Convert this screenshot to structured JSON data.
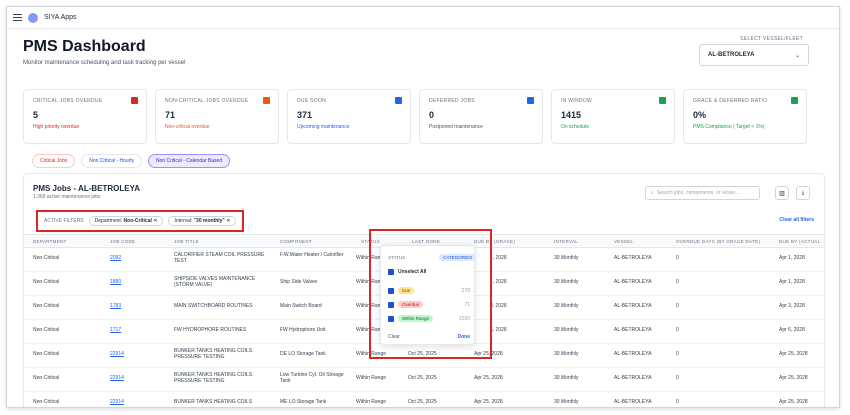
{
  "app_name": "SIYA Apps",
  "page": {
    "title": "PMS Dashboard",
    "subtitle": "Monitor maintenance scheduling and task tracking per vessel",
    "vessel_label": "SELECT VESSEL/FLEET",
    "vessel_value": "AL-BETROLEYA"
  },
  "cards": [
    {
      "label": "CRITICAL JOBS OVERDUE",
      "value": "5",
      "sub": "High priority overdue",
      "color": "#dc2626"
    },
    {
      "label": "NON-CRITICAL JOBS OVERDUE",
      "value": "71",
      "sub": "Non-critical overdue",
      "color": "#ea580c"
    },
    {
      "label": "DUE SOON",
      "value": "371",
      "sub": "Upcoming maintenance",
      "color": "#2563eb"
    },
    {
      "label": "DEFERRED JOBS",
      "value": "0",
      "sub": "Postponed maintenance",
      "color": "#2563eb"
    },
    {
      "label": "IN WINDOW",
      "value": "1415",
      "sub": "On schedule",
      "color": "#16a34a"
    },
    {
      "label": "GRACE & DEFERRED RATIO",
      "value": "0%",
      "sub": "PMS Compliance ( Target < 1%)",
      "color": "#16a34a"
    }
  ],
  "tabs": [
    "Critical Jobs",
    "Non Critical - Hourly",
    "Non Critical - Calendar Based"
  ],
  "panel": {
    "title": "PMS Jobs - AL-BETROLEYA",
    "subtitle": "1,369 active maintenance jobs",
    "search_placeholder": "Search jobs, components, or vesse...",
    "active_filters_label": "ACTIVE FILTERS",
    "filter1_key": "Department:",
    "filter1_val": "Non-Critical",
    "filter2_key": "Interval:",
    "filter2_val": "\"30 monthly\"",
    "clear_all": "Clear all filters"
  },
  "columns": [
    "DEPARTMENT",
    "JOB CODE",
    "JOB TITLE",
    "COMPONENT",
    "STATUS",
    "LAST DONE",
    "DUE BY (GRACE)",
    "INTERVAL",
    "VESSEL",
    "OVERDUE DAYS (BY GRACE DATE)",
    "DUE BY (ACTUAL"
  ],
  "rows": [
    {
      "dept": "Non-Critical",
      "code": "2092",
      "title": "CALORIFIER STEAM COIL PRESSURE TEST",
      "comp": "F.W.Water Heater / Calorifier",
      "status": "Within Rang",
      "last": "",
      "due": "1, 2028",
      "interval": "30 Monthly",
      "vessel": "AL-BETROLEYA",
      "overdue": "0",
      "actual": "Apr 1, 2028"
    },
    {
      "dept": "Non-Critical",
      "code": "1880",
      "title": "SHIPSIDE VALVES MAINTENANCE (STORM VALVE)",
      "comp": "Ship Side Valves",
      "status": "Within Rang",
      "last": "",
      "due": "1, 2028",
      "interval": "30 Monthly",
      "vessel": "AL-BETROLEYA",
      "overdue": "0",
      "actual": "Apr 1, 2028"
    },
    {
      "dept": "Non-Critical",
      "code": "1783",
      "title": "MAIN SWITCHBOARD ROUTINES",
      "comp": "Main Switch Board",
      "status": "Within Rang",
      "last": "",
      "due": "3, 2028",
      "interval": "30 Monthly",
      "vessel": "AL-BETROLEYA",
      "overdue": "0",
      "actual": "Apr 3, 2028"
    },
    {
      "dept": "Non-Critical",
      "code": "1717",
      "title": "FW HYDROPHORE ROUTINES",
      "comp": "FW Hydrophore Unit",
      "status": "Within Rang",
      "last": "",
      "due": "6, 2028",
      "interval": "30 Monthly",
      "vessel": "AL-BETROLEYA",
      "overdue": "0",
      "actual": "Apr 6, 2028"
    },
    {
      "dept": "Non-Critical",
      "code": "22914",
      "title": "BUNKER TANKS HEATING COILS PRESSURE TESTING",
      "comp": "DE LO Storage Tank",
      "status": "Within Range",
      "last": "Oct 25, 2025",
      "due": "Apr 25, 2028",
      "interval": "30 Monthly",
      "vessel": "AL-BETROLEYA",
      "overdue": "0",
      "actual": "Apr 25, 2028"
    },
    {
      "dept": "Non-Critical",
      "code": "22914",
      "title": "BUNKER TANKS HEATING COILS PRESSURE TESTING",
      "comp": "Low Turbine Cyl. Oil Storage Tank",
      "status": "Within Range",
      "last": "Oct 25, 2025",
      "due": "Apr 25, 2028",
      "interval": "30 Monthly",
      "vessel": "AL-BETROLEYA",
      "overdue": "0",
      "actual": "Apr 25, 2028"
    },
    {
      "dept": "Non-Critical",
      "code": "22914",
      "title": "BUNKER TANKS HEATING COILS",
      "comp": "ME LO Storage Tank",
      "status": "Within Range",
      "last": "Oct 25, 2025",
      "due": "Apr 25, 2028",
      "interval": "30 Monthly",
      "vessel": "AL-BETROLEYA",
      "overdue": "0",
      "actual": "Apr 25, 2028"
    }
  ],
  "dropdown": {
    "header": "STATUS",
    "badge": "CATEGORIES",
    "unselect": "Unselect All",
    "options": [
      {
        "label": "Due",
        "count": "278",
        "bg": "#fde68a",
        "fg": "#92400e"
      },
      {
        "label": "Overdue",
        "count": "71",
        "bg": "#fecaca",
        "fg": "#b91c1c"
      },
      {
        "label": "Within Range",
        "count": "1020",
        "bg": "#bbf7d0",
        "fg": "#166534"
      }
    ],
    "clear": "Clear",
    "done": "Done"
  }
}
